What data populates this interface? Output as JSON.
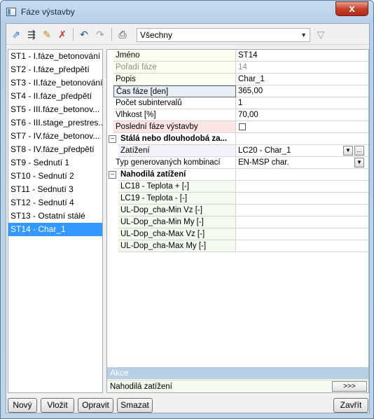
{
  "window": {
    "title": "Fáze výstavby",
    "close_glyph": "x"
  },
  "toolbar": {
    "icons": [
      "copy-phase-icon",
      "edit-table-icon",
      "pencil-icon",
      "delete-marked-icon",
      "undo-icon",
      "redo-icon",
      "print-icon"
    ],
    "filter_value": "Všechny",
    "filter_icon": "funnel-icon"
  },
  "phase_list": [
    "ST1 - I.fáze_betonování",
    "ST2 - I.fáze_předpětí",
    "ST3 - II.fáze_betonování",
    "ST4 - II.fáze_předpětí",
    "ST5 - III.fáze_betonov...",
    "ST6 - III.stage_prestres...",
    "ST7 - IV.fáze_betonov...",
    "ST8 - IV.fáze_předpětí",
    "ST9 - Sednutí 1",
    "ST10 - Sednutí 2",
    "ST11 - Sednutí 3",
    "ST12 - Sednutí 4",
    "ST13 - Ostatní stálé",
    "ST14 - Char_1"
  ],
  "selected_index": 13,
  "properties": {
    "name_label": "Jméno",
    "name_value": "ST14",
    "order_label": "Pořadí fáze",
    "order_value": "14",
    "desc_label": "Popis",
    "desc_value": "Char_1",
    "time_label": "Čas fáze [den]",
    "time_value": "365,00",
    "subint_label": "Počet subintervalů",
    "subint_value": "1",
    "humidity_label": "Vlhkost [%]",
    "humidity_value": "70,00",
    "last_label": "Poslední fáze výstavby",
    "last_checked": false,
    "permanent_group": "Stálá nebo dlouhodobá za...",
    "loading_label": "Zatížení",
    "loading_value": "LC20 - Char_1",
    "combi_label": "Typ generovaných kombinací",
    "combi_value": "EN-MSP char.",
    "variable_group": "Nahodilá zatížení",
    "variable_items": [
      "LC18 - Teplota + [-]",
      "LC19 - Teplota - [-]",
      "UL-Dop_cha-Min Vz [-]",
      "UL-Dop_cha-Min My [-]",
      "UL-Dop_cha-Max Vz [-]",
      "UL-Dop_cha-Max My [-]"
    ],
    "ellipsis": "..."
  },
  "actions": {
    "header": "Akce",
    "row_label": "Nahodilá zatížení",
    "row_button": ">>>"
  },
  "buttons": {
    "new": "Nový",
    "insert": "Vložit",
    "edit": "Opravit",
    "delete": "Smazat",
    "close": "Zavřít"
  }
}
